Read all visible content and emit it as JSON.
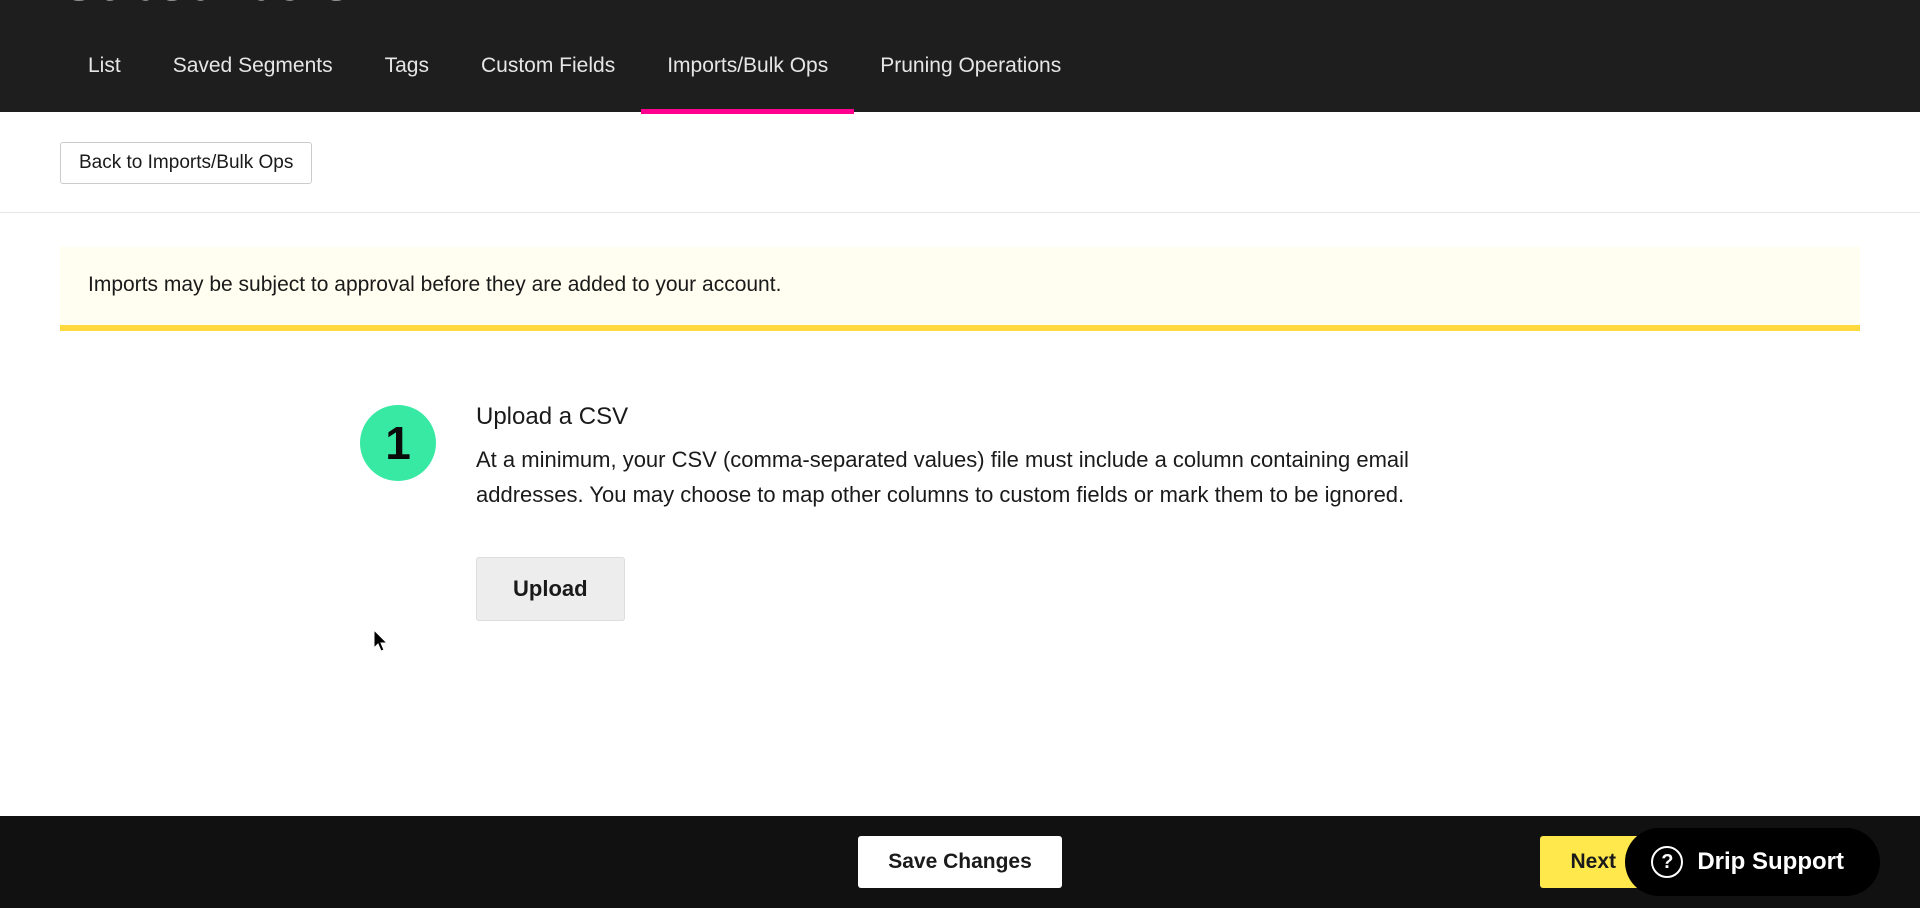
{
  "page_title": "Subscribers",
  "tabs": [
    {
      "label": "List",
      "active": false
    },
    {
      "label": "Saved Segments",
      "active": false
    },
    {
      "label": "Tags",
      "active": false
    },
    {
      "label": "Custom Fields",
      "active": false
    },
    {
      "label": "Imports/Bulk Ops",
      "active": true
    },
    {
      "label": "Pruning Operations",
      "active": false
    }
  ],
  "back_button": "Back to Imports/Bulk Ops",
  "notice": "Imports may be subject to approval before they are added to your account.",
  "step": {
    "number": "1",
    "title": "Upload a CSV",
    "description": "At a minimum, your CSV (comma-separated values) file must include a column containing email addresses. You may choose to map other columns to custom fields or mark them to be ignored.",
    "upload_label": "Upload"
  },
  "footer": {
    "save_label": "Save Changes",
    "next_label": "Next",
    "support_label": "Drip Support"
  }
}
